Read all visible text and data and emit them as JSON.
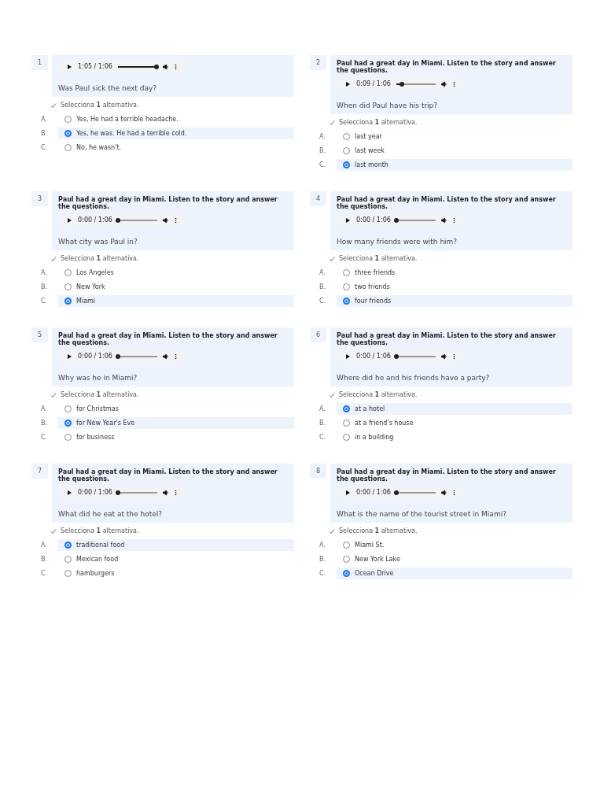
{
  "questions": [
    {
      "number": "1",
      "time": "1:05 / 1:06",
      "level": 0.98,
      "question": "Was Paul sick the next day?",
      "hint": "Selecciona **1** alternativa.",
      "options": [
        {
          "letter": "A.",
          "text": "Yes, He had a terrible headache.",
          "selected": false
        },
        {
          "letter": "B.",
          "text": "Yes, he was. He had a terrible cold.",
          "selected": true
        },
        {
          "letter": "C.",
          "text": "No, he wasn't.",
          "selected": false
        }
      ]
    },
    {
      "number": "2",
      "intro": "Paul had a great day in Miami. Listen to the story and answer the questions.",
      "time": "0:09 / 1:06",
      "level": 0.14,
      "question": "When did Paul have his trip?",
      "hint": "Selecciona **1** alternativa.",
      "options": [
        {
          "letter": "A.",
          "text": "last year",
          "selected": false
        },
        {
          "letter": "B.",
          "text": "last week",
          "selected": false
        },
        {
          "letter": "C.",
          "text": "last month",
          "selected": true
        }
      ]
    },
    {
      "number": "3",
      "intro": "Paul had a great day in Miami. Listen to the story and answer the questions.",
      "time": "0:00 / 1:06",
      "level": 0,
      "question": "What city was Paul in?",
      "hint": "Selecciona **1** alternativa.",
      "options": [
        {
          "letter": "A.",
          "text": "Los Angeles",
          "selected": false
        },
        {
          "letter": "B.",
          "text": "New York",
          "selected": false
        },
        {
          "letter": "C.",
          "text": "Miami",
          "selected": true
        }
      ]
    },
    {
      "number": "4",
      "intro": "Paul had a great day in Miami. Listen to the story and answer the questions.",
      "time": "0:00 / 1:06",
      "level": 0,
      "question": "How many friends were with him?",
      "hint": "Selecciona **1** alternativa.",
      "options": [
        {
          "letter": "A.",
          "text": "three friends",
          "selected": false
        },
        {
          "letter": "B.",
          "text": "two friends",
          "selected": false
        },
        {
          "letter": "C.",
          "text": "four friends",
          "selected": true
        }
      ]
    },
    {
      "number": "5",
      "intro": "Paul had a great day in Miami. Listen to the story and answer the questions.",
      "time": "0:00 / 1:06",
      "level": 0,
      "question": "Why was he in Miami?",
      "hint": "Selecciona **1** alternativa.",
      "options": [
        {
          "letter": "A.",
          "text": "for Christmas",
          "selected": false
        },
        {
          "letter": "B.",
          "text": "for New Year's Eve",
          "selected": true
        },
        {
          "letter": "C.",
          "text": "for business",
          "selected": false
        }
      ]
    },
    {
      "number": "6",
      "intro": "Paul had a great day in Miami. Listen to the story and answer the questions.",
      "time": "0:00 / 1:06",
      "level": 0,
      "question": "Where did he and his friends have a party?",
      "hint": "Selecciona **1** alternativa.",
      "options": [
        {
          "letter": "A.",
          "text": "at a hotel",
          "selected": true
        },
        {
          "letter": "B.",
          "text": "at a friend's house",
          "selected": false
        },
        {
          "letter": "C.",
          "text": "in a building",
          "selected": false
        }
      ]
    },
    {
      "number": "7",
      "intro": "Paul had a great day in Miami. Listen to the story and answer the questions.",
      "time": "0:00 / 1:06",
      "level": 0,
      "question": "What did he eat at the hotel?",
      "hint": "Selecciona **1** alternativa.",
      "options": [
        {
          "letter": "A.",
          "text": "traditional food",
          "selected": true
        },
        {
          "letter": "B.",
          "text": "Mexican food",
          "selected": false
        },
        {
          "letter": "C.",
          "text": "hamburgers",
          "selected": false
        }
      ]
    },
    {
      "number": "8",
      "intro": "Paul had a great day in Miami. Listen to the story and answer the questions.",
      "time": "0:00 / 1:06",
      "level": 0,
      "question": "What is the name of the tourist street in Miami?",
      "hint": "Selecciona **1** alternativa.",
      "options": [
        {
          "letter": "A.",
          "text": "Miami St.",
          "selected": false
        },
        {
          "letter": "B.",
          "text": "New York Lake",
          "selected": false
        },
        {
          "letter": "C.",
          "text": "Ocean Drive",
          "selected": true
        }
      ]
    }
  ]
}
